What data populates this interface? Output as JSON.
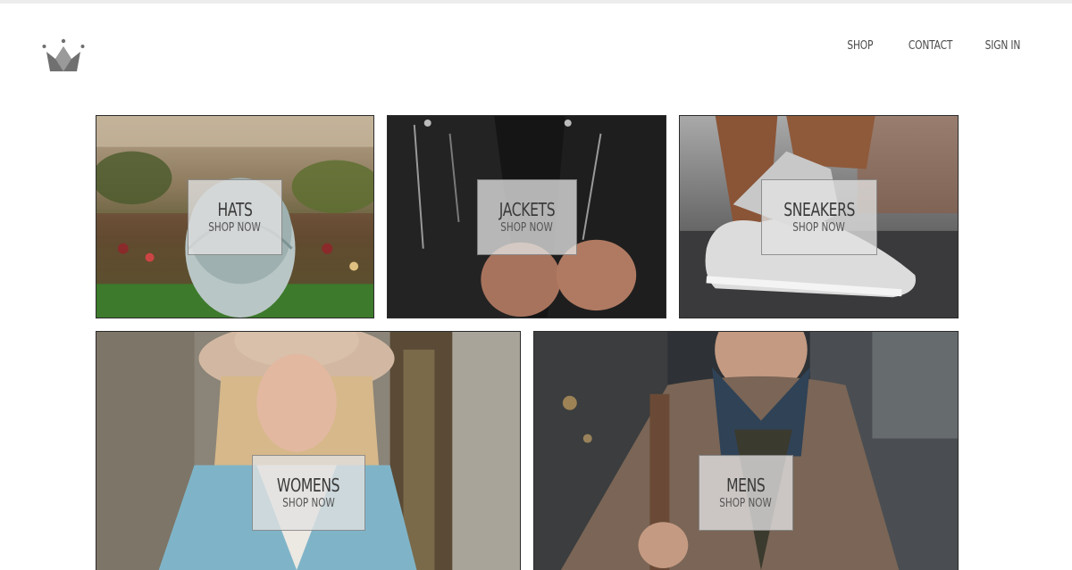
{
  "nav": {
    "logo_icon": "crown-icon",
    "items": [
      {
        "label": "SHOP"
      },
      {
        "label": "CONTACT"
      },
      {
        "label": "SIGN IN"
      }
    ]
  },
  "categories": [
    {
      "title": "HATS",
      "cta": "SHOP NOW"
    },
    {
      "title": "JACKETS",
      "cta": "SHOP NOW"
    },
    {
      "title": "SNEAKERS",
      "cta": "SHOP NOW"
    },
    {
      "title": "WOMENS",
      "cta": "SHOP NOW"
    },
    {
      "title": "MENS",
      "cta": "SHOP NOW"
    }
  ],
  "colors": {
    "logo": "#6f6f6f",
    "nav_text": "#4a4a4a",
    "tile_border": "#2c2c2c",
    "label_overlay": "#e1e1e1"
  }
}
